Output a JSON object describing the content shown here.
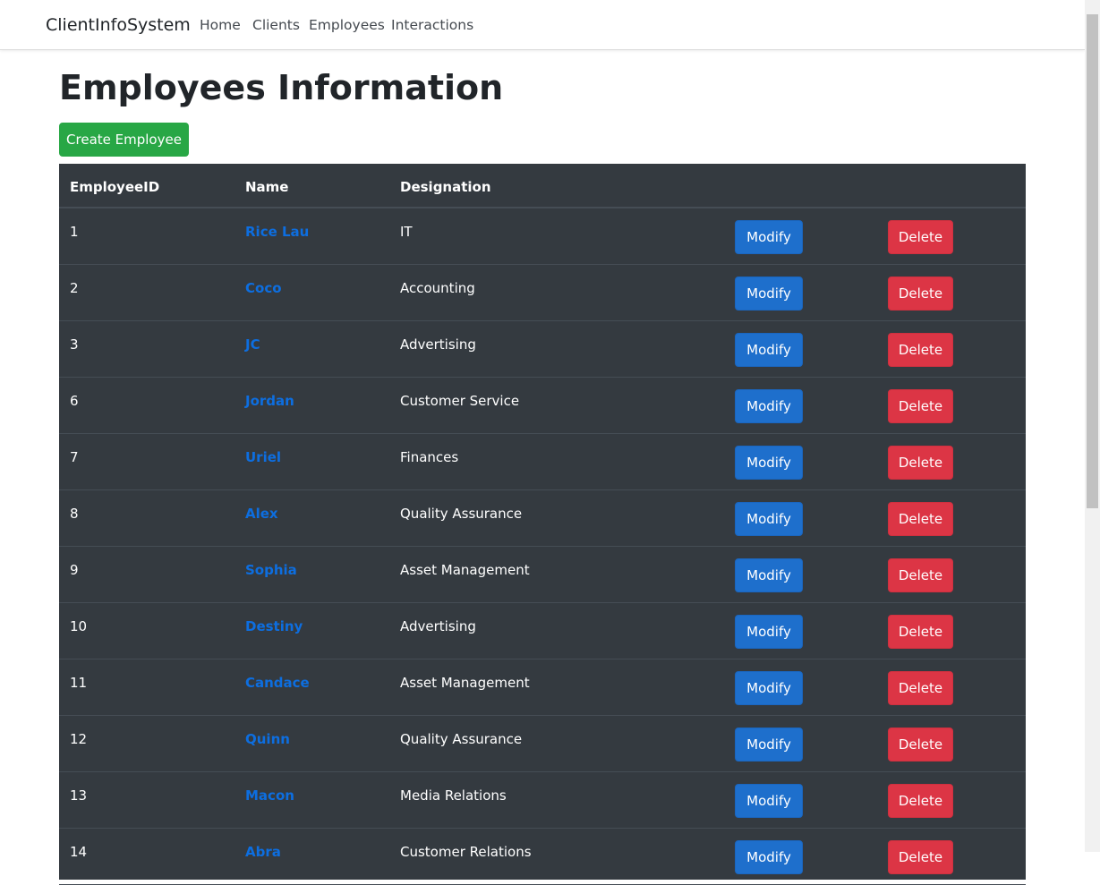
{
  "navbar": {
    "brand": "ClientInfoSystem",
    "links": [
      {
        "label": "Home"
      },
      {
        "label": "Clients"
      },
      {
        "label": "Employees"
      },
      {
        "label": "Interactions"
      }
    ]
  },
  "page": {
    "title": "Employees Information",
    "create_label": "Create Employee"
  },
  "table": {
    "headers": [
      "EmployeeID",
      "Name",
      "Designation"
    ],
    "modify_label": "Modify",
    "delete_label": "Delete",
    "rows": [
      {
        "id": "1",
        "name": "Rice Lau",
        "designation": "IT"
      },
      {
        "id": "2",
        "name": "Coco",
        "designation": "Accounting"
      },
      {
        "id": "3",
        "name": "JC",
        "designation": "Advertising"
      },
      {
        "id": "6",
        "name": "Jordan",
        "designation": "Customer Service"
      },
      {
        "id": "7",
        "name": "Uriel",
        "designation": "Finances"
      },
      {
        "id": "8",
        "name": "Alex",
        "designation": "Quality Assurance"
      },
      {
        "id": "9",
        "name": "Sophia",
        "designation": "Asset Management"
      },
      {
        "id": "10",
        "name": "Destiny",
        "designation": "Advertising"
      },
      {
        "id": "11",
        "name": "Candace",
        "designation": "Asset Management"
      },
      {
        "id": "12",
        "name": "Quinn",
        "designation": "Quality Assurance"
      },
      {
        "id": "13",
        "name": "Macon",
        "designation": "Media Relations"
      },
      {
        "id": "14",
        "name": "Abra",
        "designation": "Customer Relations"
      }
    ]
  },
  "colors": {
    "table_bg": "#343a40",
    "link": "#0d6ee0",
    "modify": "#1e6fcc",
    "delete": "#dc3545",
    "create": "#28a745"
  }
}
